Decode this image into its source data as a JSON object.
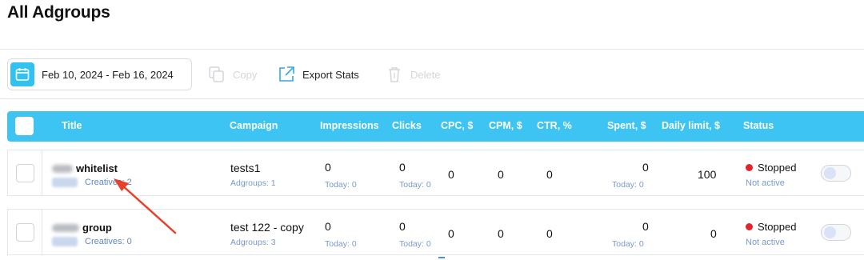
{
  "page": {
    "title": "All Adgroups"
  },
  "toolbar": {
    "date_range": "Feb 10, 2024 - Feb 16, 2024",
    "copy_label": "Copy",
    "export_label": "Export Stats",
    "delete_label": "Delete"
  },
  "table": {
    "columns": [
      "Title",
      "Campaign",
      "Impressions",
      "Clicks",
      "CPC, $",
      "CPM, $",
      "CTR, %",
      "Spent, $",
      "Daily limit, $",
      "Status"
    ],
    "rows": [
      {
        "title": "whitelist",
        "creatives": "Creatives: 2",
        "campaign": "tests1",
        "adgroups": "Adgroups: 1",
        "impressions": "0",
        "impressions_today": "Today: 0",
        "clicks": "0",
        "clicks_today": "Today: 0",
        "cpc": "0",
        "cpm": "0",
        "ctr": "0",
        "spent": "0",
        "spent_today": "Today: 0",
        "daily_limit": "100",
        "status": "Stopped",
        "status_sub": "Not active"
      },
      {
        "title": "group",
        "creatives": "Creatives: 0",
        "campaign": "test 122 - copy",
        "adgroups": "Adgroups: 3",
        "impressions": "0",
        "impressions_today": "Today: 0",
        "clicks": "0",
        "clicks_today": "Today: 0",
        "cpc": "0",
        "cpm": "0",
        "ctr": "0",
        "spent": "0",
        "spent_today": "Today: 0",
        "daily_limit": "0",
        "status": "Stopped",
        "status_sub": "Not active"
      }
    ]
  },
  "colors": {
    "header_bg": "#3dc4f2",
    "status_stopped": "#e5232d",
    "annotation_arrow": "#e8412b",
    "link_blue": "#5f86c4"
  },
  "icons": {
    "date": "calendar-icon",
    "copy": "copy-icon",
    "export": "export-icon",
    "delete": "trash-icon"
  }
}
